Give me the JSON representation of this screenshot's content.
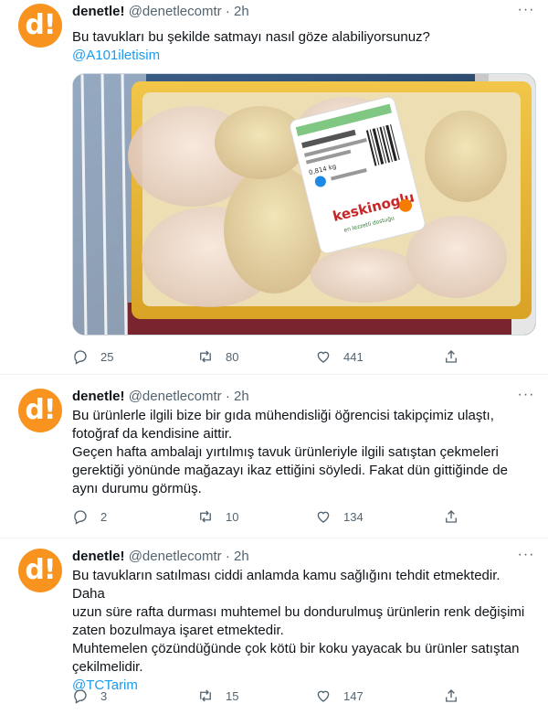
{
  "tweets": [
    {
      "name": "denetle!",
      "handle": "@denetlecomtr",
      "separator": "·",
      "time": "2h",
      "lines": [
        "Bu tavukları bu şekilde satmayı nasıl göze alabiliyorsunuz?"
      ],
      "mention": "@A101iletisim",
      "photo": {
        "package_brand": "keskinoglu",
        "package_tagline": "en lezzetli dostuğu",
        "package_weight": "0,814 kg"
      },
      "replies": "25",
      "retweets": "80",
      "likes": "441"
    },
    {
      "name": "denetle!",
      "handle": "@denetlecomtr",
      "separator": "·",
      "time": "2h",
      "lines": [
        "Bu ürünlerle ilgili bize bir gıda mühendisliği öğrencisi takipçimiz ulaştı,",
        "fotoğraf da kendisine aittir.",
        "Geçen hafta ambalajı yırtılmış tavuk ürünleriyle ilgili satıştan çekmeleri",
        "gerektiği yönünde mağazayı ikaz ettiğini söyledi. Fakat dün gittiğinde de",
        "aynı durumu görmüş."
      ],
      "replies": "2",
      "retweets": "10",
      "likes": "134"
    },
    {
      "name": "denetle!",
      "handle": "@denetlecomtr",
      "separator": "·",
      "time": "2h",
      "lines": [
        "Bu tavukların satılması ciddi anlamda kamu sağlığını tehdit etmektedir. Daha",
        "uzun süre rafta durması muhtemel bu dondurulmuş ürünlerin renk değişimi",
        "zaten bozulmaya işaret etmektedir.",
        "Muhtemelen çözündüğünde çok kötü bir koku yayacak bu ürünler satıştan",
        "çekilmelidir."
      ],
      "mention": "@TCTarim",
      "replies": "3",
      "retweets": "15",
      "likes": "147"
    }
  ],
  "avatar_text": "d!",
  "more_glyph": "···",
  "colors": {
    "accent": "#1d9bf0",
    "avatar_bg": "#f7931e",
    "muted": "#536471",
    "text": "#0f1419"
  },
  "icons": [
    "reply-icon",
    "retweet-icon",
    "like-icon",
    "share-icon",
    "more-icon"
  ]
}
